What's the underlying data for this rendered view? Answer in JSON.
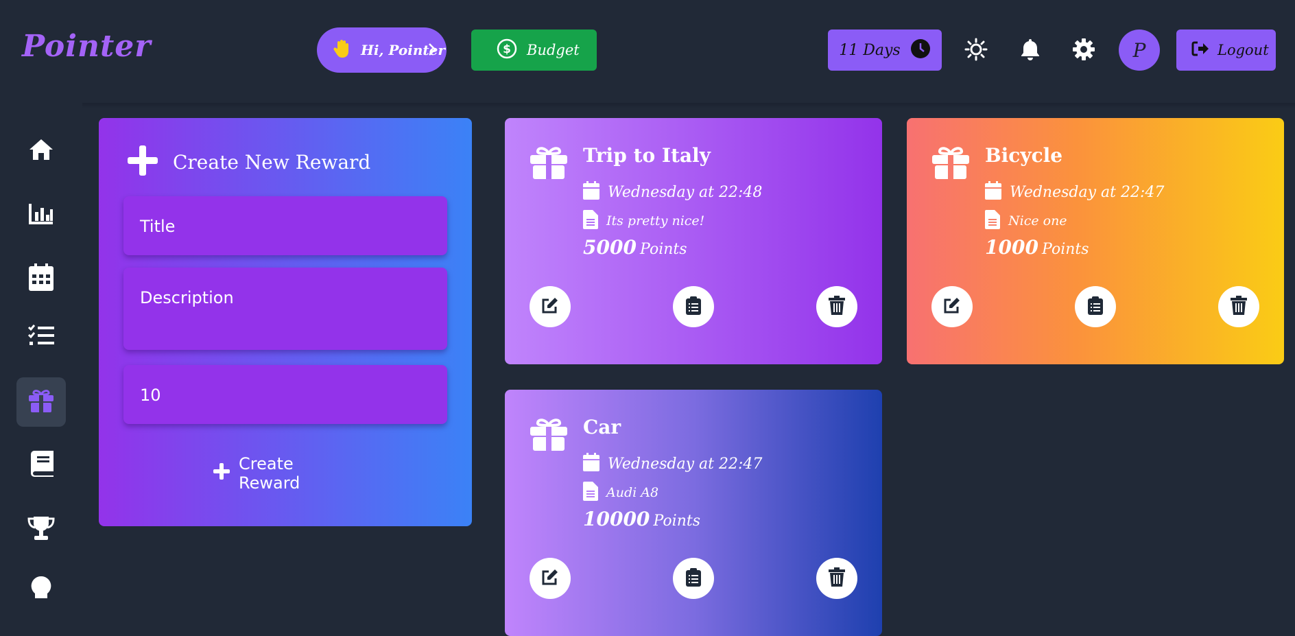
{
  "header": {
    "logo": "Pointer",
    "greeting_label": "Hi, Pointer",
    "budget_label": "Budget",
    "days_label": "11 Days",
    "avatar_letter": "P",
    "logout_label": "Logout"
  },
  "sidebar": {
    "items": [
      "home",
      "stats",
      "calendar",
      "tasks",
      "rewards",
      "journal",
      "achievements",
      "ideas"
    ],
    "active": "rewards"
  },
  "create_form": {
    "heading": "Create New Reward",
    "title_placeholder": "Title",
    "description_placeholder": "Description",
    "points_value": "10",
    "submit_label": "Create Reward"
  },
  "rewards": [
    {
      "title": "Trip to Italy",
      "date": "Wednesday at 22:48",
      "description": "Its pretty nice!",
      "points": "5000",
      "points_unit": "Points"
    },
    {
      "title": "Bicycle",
      "date": "Wednesday at 22:47",
      "description": "Nice one",
      "points": "1000",
      "points_unit": "Points"
    },
    {
      "title": "Car",
      "date": "Wednesday at 22:47",
      "description": "Audi A8",
      "points": "10000",
      "points_unit": "Points"
    }
  ],
  "colors": {
    "background": "#212937",
    "accent": "#8b5cf6",
    "budget": "#16a34a",
    "purple_card": "#9333ea",
    "orange_start": "#f87171",
    "yellow_end": "#facc15",
    "blue_end": "#1e40af"
  }
}
